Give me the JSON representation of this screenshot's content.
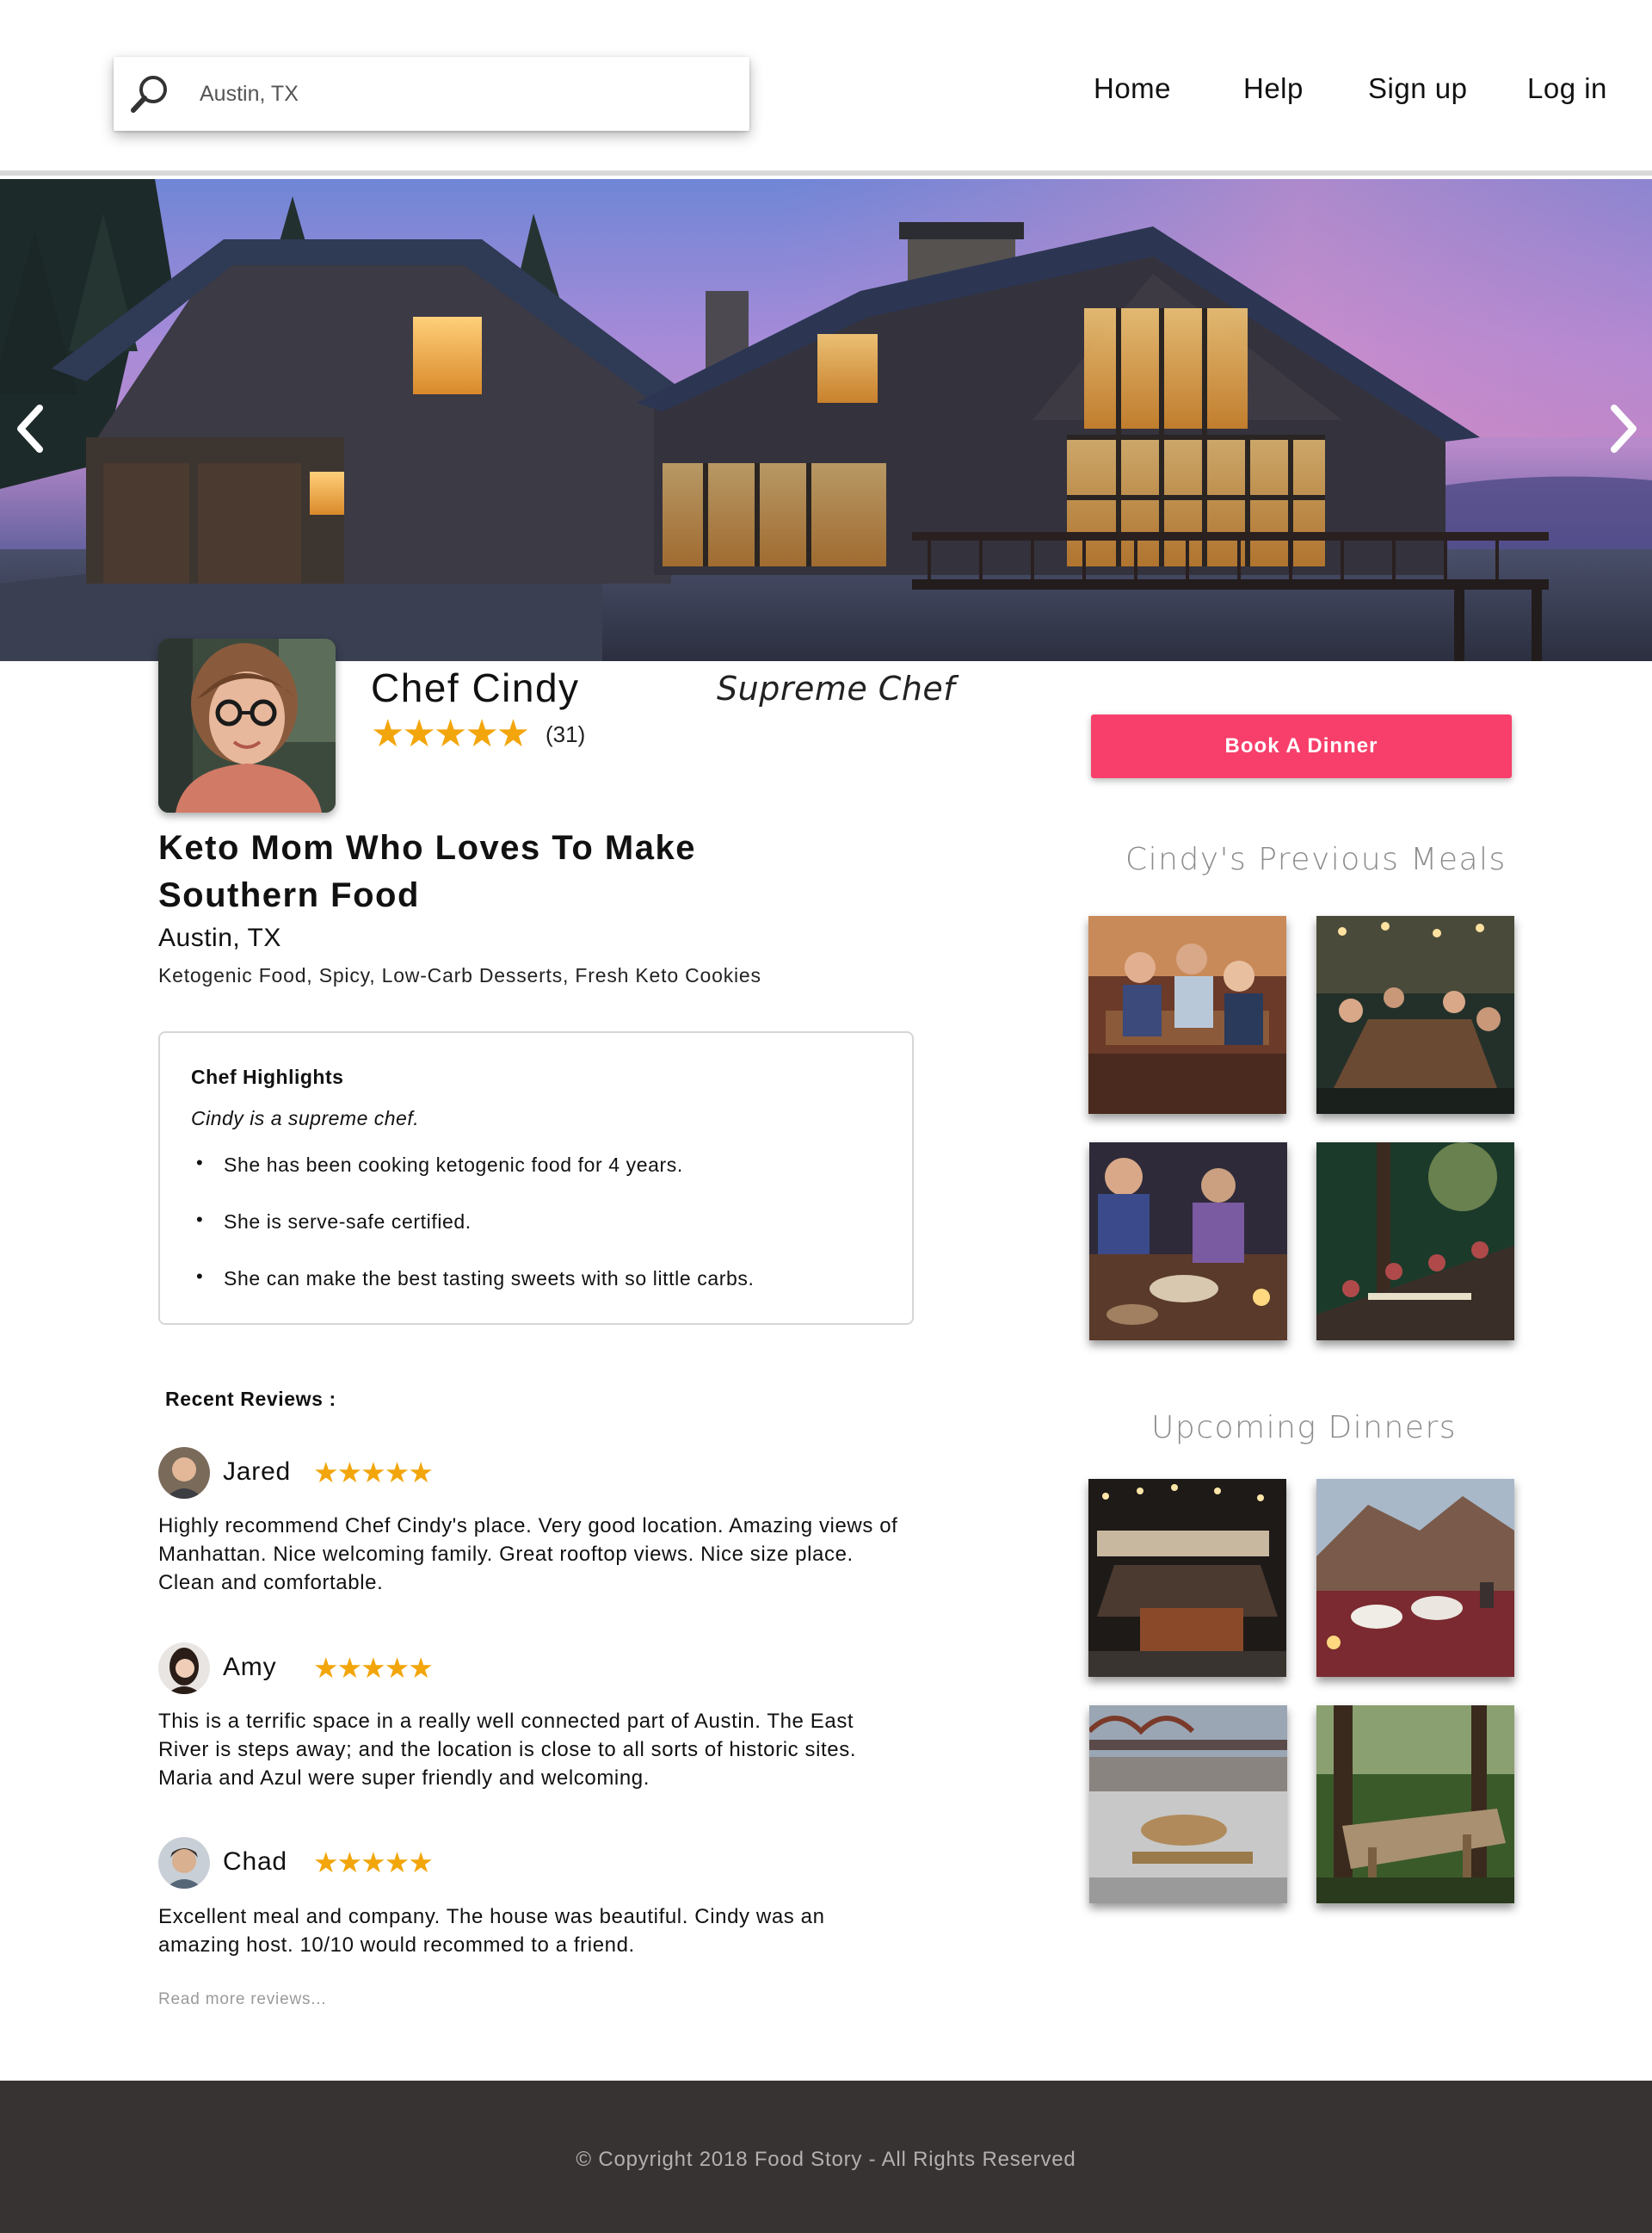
{
  "header": {
    "search": {
      "value": "Austin, TX",
      "placeholder": ""
    },
    "nav": [
      "Home",
      "Help",
      "Sign up",
      "Log in"
    ]
  },
  "hero": {
    "prev_icon": "chevron-left-icon",
    "next_icon": "chevron-right-icon"
  },
  "chef": {
    "name": "Chef Cindy",
    "title": "Supreme Chef",
    "stars": "★★★★★",
    "rating": 5,
    "rating_count": "(31)",
    "headline": "Keto Mom Who Loves To Make Southern Food",
    "location": "Austin, TX",
    "cuisines": "Ketogenic Food, Spicy, Low-Carb Desserts, Fresh Keto Cookies"
  },
  "highlights": {
    "title": "Chef Highlights",
    "subtitle": "Cindy is a supreme chef.",
    "items": [
      "She has been cooking ketogenic food for 4 years.",
      "She is serve-safe certified.",
      "She can make the best tasting sweets with so little carbs."
    ]
  },
  "reviews": {
    "heading": "Recent Reviews :",
    "items": [
      {
        "name": "Jared",
        "stars": "★★★★★",
        "rating": 5,
        "text": "Highly recommend Chef Cindy's place. Very good location. Amazing views of Manhattan. Nice welcoming family. Great rooftop views. Nice size place. Clean and comfortable."
      },
      {
        "name": "Amy",
        "stars": "★★★★★",
        "rating": 5,
        "text": "This is a terrific space in a really well connected part of Austin. The East River is steps away; and the location is close to all sorts of historic sites. Maria and Azul were super friendly and welcoming."
      },
      {
        "name": "Chad",
        "stars": "★★★★★",
        "rating": 5,
        "text": "Excellent meal and company. The house was beautiful. Cindy was an amazing host. 10/10 would recommed to a friend."
      }
    ],
    "read_more": "Read more reviews..."
  },
  "sidebar": {
    "book_label": "Book A Dinner",
    "previous_title": "Cindy's Previous Meals",
    "upcoming_title": "Upcoming Dinners"
  },
  "colors": {
    "accent": "#f83f6b",
    "star": "#f2a60c",
    "footer_bg": "#373333"
  },
  "footer": {
    "copyright": "© Copyright 2018 Food Story - All Rights Reserved"
  }
}
